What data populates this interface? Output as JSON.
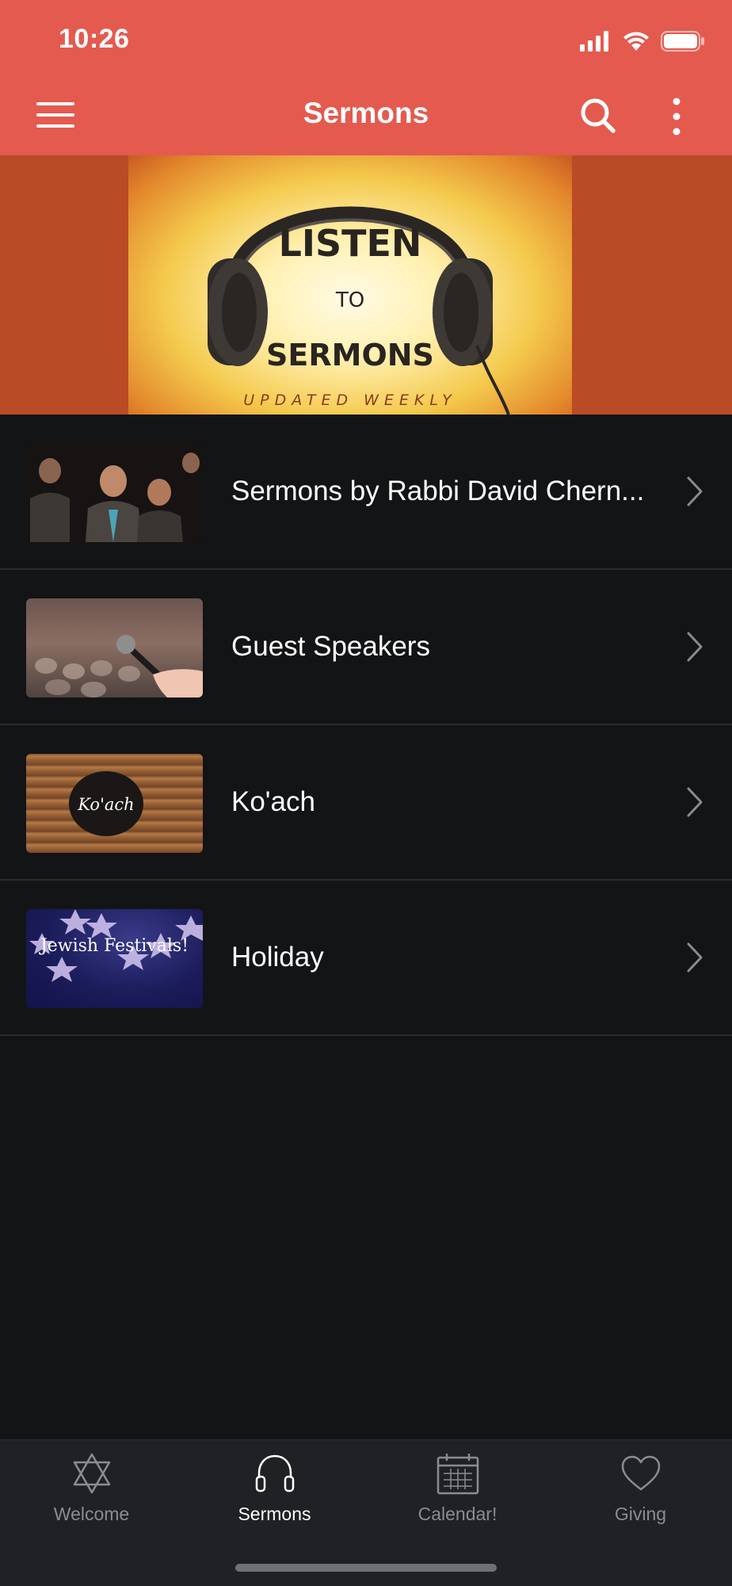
{
  "status_bar": {
    "time": "10:26"
  },
  "header": {
    "title": "Sermons"
  },
  "banner": {
    "line1": "LISTEN",
    "line2": "TO",
    "line3": "SERMONS",
    "line4": "UPDATED WEEKLY"
  },
  "list": {
    "items": [
      {
        "label": "Sermons by Rabbi David Chern..."
      },
      {
        "label": "Guest Speakers"
      },
      {
        "label": "Ko'ach",
        "thumb_text": "Ko'ach"
      },
      {
        "label": "Holiday",
        "thumb_text": "Jewish Festivals!"
      }
    ]
  },
  "tabbar": {
    "tabs": [
      {
        "label": "Welcome",
        "icon": "star-of-david-icon",
        "active": false
      },
      {
        "label": "Sermons",
        "icon": "headphones-icon",
        "active": true
      },
      {
        "label": "Calendar!",
        "icon": "calendar-icon",
        "active": false
      },
      {
        "label": "Giving",
        "icon": "heart-icon",
        "active": false
      }
    ]
  },
  "colors": {
    "header": "#e45a4f",
    "background": "#131416",
    "tabbar": "#202124",
    "active_tab": "#ffffff",
    "inactive_tab": "#8b8c90"
  }
}
